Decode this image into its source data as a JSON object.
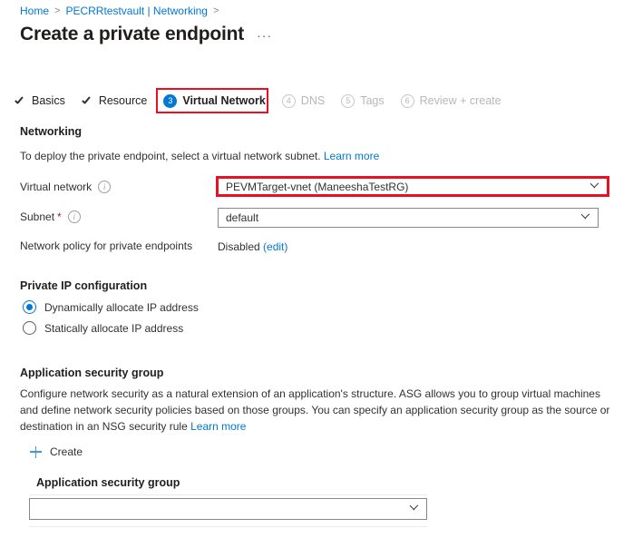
{
  "breadcrumb": {
    "items": [
      {
        "label": "Home"
      },
      {
        "label": "PECRRtestvault | Networking"
      }
    ],
    "separator": ">"
  },
  "header": {
    "title": "Create a private endpoint",
    "more_menu": "···"
  },
  "tabs": [
    {
      "label": "Basics",
      "state": "done",
      "marker": "check"
    },
    {
      "label": "Resource",
      "state": "done",
      "marker": "check"
    },
    {
      "label": "Virtual Network",
      "state": "active",
      "marker": "3",
      "highlighted": true
    },
    {
      "label": "DNS",
      "state": "disabled",
      "marker": "4"
    },
    {
      "label": "Tags",
      "state": "disabled",
      "marker": "5"
    },
    {
      "label": "Review + create",
      "state": "disabled",
      "marker": "6"
    }
  ],
  "networking": {
    "heading": "Networking",
    "description": "To deploy the private endpoint, select a virtual network subnet.",
    "learn_more": "Learn more",
    "virtual_network": {
      "label": "Virtual network",
      "info": "ⓘ",
      "value": "PEVMTarget-vnet (ManeeshaTestRG)",
      "highlighted": true
    },
    "subnet": {
      "label": "Subnet",
      "required_marker": "*",
      "info": "ⓘ",
      "value": "default"
    },
    "network_policy": {
      "label": "Network policy for private endpoints",
      "value": "Disabled",
      "edit_link": "(edit)"
    }
  },
  "private_ip": {
    "heading": "Private IP configuration",
    "options": [
      {
        "label": "Dynamically allocate IP address",
        "selected": true
      },
      {
        "label": "Statically allocate IP address",
        "selected": false
      }
    ]
  },
  "application_security_group": {
    "heading": "Application security group",
    "description_line1": "Configure network security as a natural extension of an application's structure. ASG allows you to group virtual machines and",
    "description_line2": "define network security policies based on those groups. You can specify an application security group as the source or",
    "description_line3": "destination in an NSG security rule",
    "learn_more": "Learn more",
    "create_label": "Create",
    "field_label": "Application security group",
    "field_value": ""
  },
  "colors": {
    "accent": "#0078d4",
    "highlight": "#e81123",
    "text": "#323130",
    "disabled": "#b9b7b5"
  }
}
